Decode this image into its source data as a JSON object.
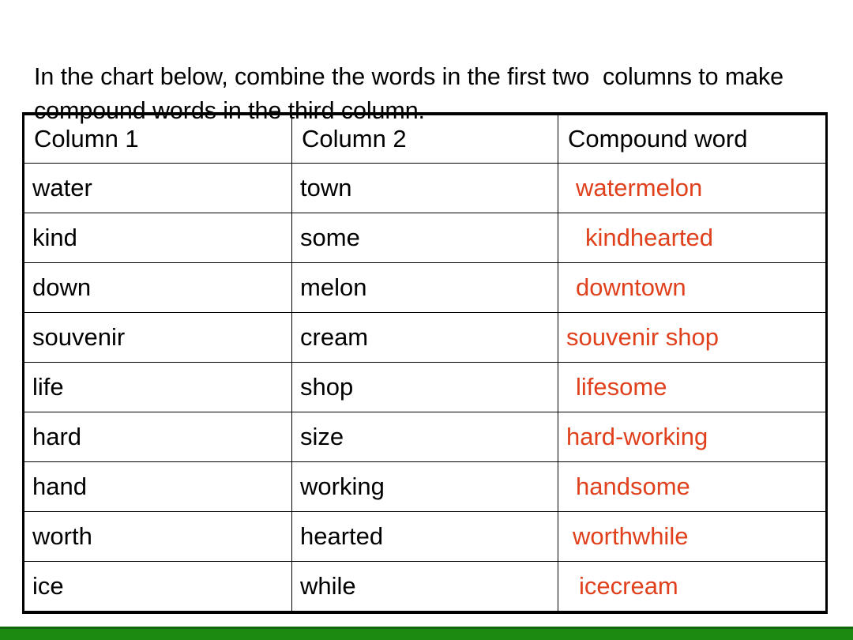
{
  "slide": {
    "instructions": "In the chart below, combine the words in the first two  columns to make compound words in the third column.",
    "accent_green": "#1C8A11",
    "answer_red": "#E0401C",
    "text_black": "#000000"
  },
  "table": {
    "headers": [
      "Column 1",
      "Column 2",
      "Compound word"
    ],
    "rows": [
      {
        "col1": " water",
        "col2": "town",
        "answer": "watermelon"
      },
      {
        "col1": "kind",
        "col2": "some",
        "answer": "kindhearted"
      },
      {
        "col1": "down",
        "col2": "melon",
        "answer": "downtown"
      },
      {
        "col1": "souvenir",
        "col2": "cream",
        "answer": "souvenir shop"
      },
      {
        "col1": "life",
        "col2": "shop",
        "answer": "lifesome"
      },
      {
        "col1": "hard",
        "col2": "size",
        "answer": "hard-working"
      },
      {
        "col1": "hand",
        "col2": "working",
        "answer": "handsome"
      },
      {
        "col1": "worth",
        "col2": "hearted",
        "answer": "worthwhile"
      },
      {
        "col1": "ice",
        "col2": "while",
        "answer": "icecream"
      }
    ]
  }
}
